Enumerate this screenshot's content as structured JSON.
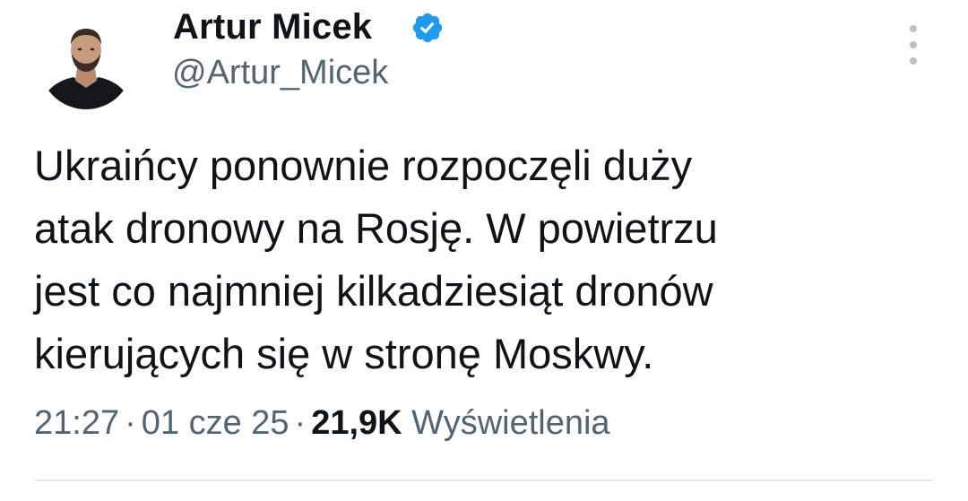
{
  "author": {
    "display_name": "Artur Micek",
    "handle": "@Artur_Micek",
    "verified": true,
    "verified_color": "#1d9bf0"
  },
  "tweet": {
    "text_lines": [
      "Ukraińcy ponownie rozpoczęli duży",
      "atak dronowy na Rosję. W powietrzu",
      "jest co najmniej kilkadziesiąt dronów",
      "kierujących się w stronę Moskwy."
    ]
  },
  "meta": {
    "time": "21:27",
    "separator": "·",
    "date": "01 cze 25",
    "views_count": "21,9K",
    "views_label": "Wyświetlenia"
  },
  "icons": {
    "more": "more-vertical-icon",
    "verified": "verified-badge-icon"
  }
}
